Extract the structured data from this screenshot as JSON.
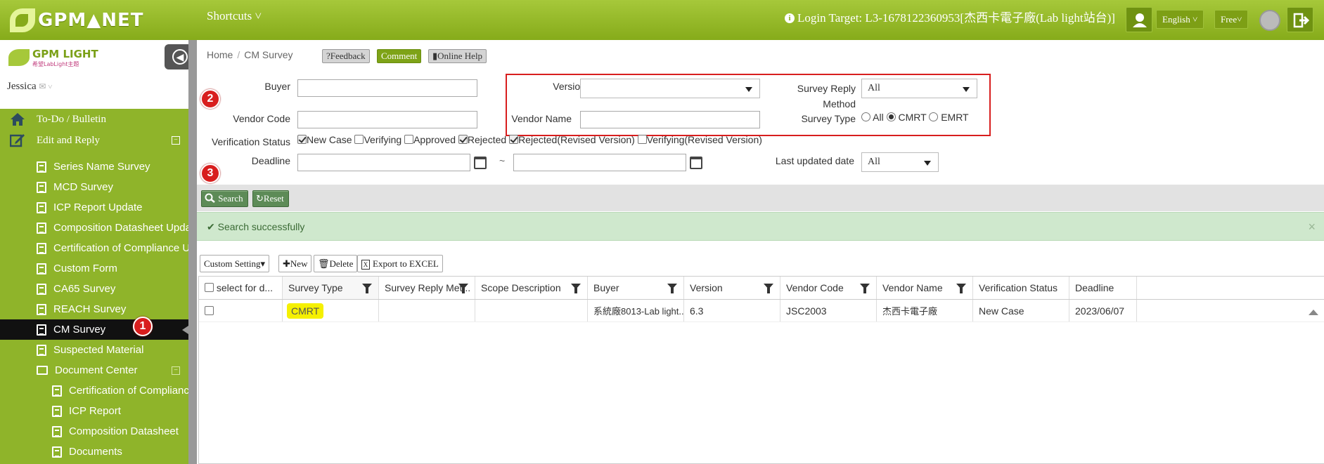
{
  "topbar": {
    "logo_text": "GPM▲NET",
    "shortcuts_label": "Shortcuts",
    "login_target": "Login Target: L3-1678122360953[杰西卡電子廠(Lab light站台)]",
    "language": "English",
    "plan": "Free"
  },
  "sidebar": {
    "logo_text": "GPM LIGHT",
    "logo_sub": "希望LabLight主題",
    "user_name": "Jessica",
    "top_items": [
      {
        "label": "To-Do / Bulletin"
      },
      {
        "label": "Edit and Reply"
      }
    ],
    "items": [
      {
        "label": "Series Name Survey"
      },
      {
        "label": "MCD Survey"
      },
      {
        "label": "ICP Report Update"
      },
      {
        "label": "Composition Datasheet Update"
      },
      {
        "label": "Certification of Compliance Update"
      },
      {
        "label": "Custom Form"
      },
      {
        "label": "CA65 Survey"
      },
      {
        "label": "REACH Survey"
      },
      {
        "label": "CM Survey"
      },
      {
        "label": "Suspected Material"
      },
      {
        "label": "Document Center"
      }
    ],
    "sub_items": [
      {
        "label": "Certification of Compliance"
      },
      {
        "label": "ICP Report"
      },
      {
        "label": "Composition Datasheet"
      },
      {
        "label": "Documents"
      }
    ]
  },
  "badges": {
    "one": "1",
    "two": "2",
    "three": "3"
  },
  "breadcrumb": {
    "home": "Home",
    "separator": "/",
    "current": "CM Survey"
  },
  "header_buttons": {
    "feedback": "?Feedback",
    "comment": "Comment",
    "help": "Online Help"
  },
  "form": {
    "buyer_label": "Buyer",
    "buyer_value": "",
    "vendor_code_label": "Vendor Code",
    "vendor_code_value": "",
    "version_label": "Version",
    "version_value": "",
    "vendor_name_label": "Vendor Name",
    "vendor_name_value": "",
    "reply_method_label": "Survey Reply Method",
    "reply_method_value": "All",
    "survey_type_label": "Survey Type",
    "survey_type_options": [
      "All",
      "CMRT",
      "EMRT"
    ],
    "survey_type_selected": "CMRT",
    "verification_label": "Verification Status",
    "verification_options": [
      {
        "label": "New Case",
        "checked": true
      },
      {
        "label": "Verifying",
        "checked": false
      },
      {
        "label": "Approved",
        "checked": false
      },
      {
        "label": "Rejected",
        "checked": true
      },
      {
        "label": "Rejected(Revised Version)",
        "checked": true
      },
      {
        "label": "Verifying(Revised Version)",
        "checked": false
      }
    ],
    "deadline_label": "Deadline",
    "deadline_sep": "~",
    "last_updated_label": "Last updated date",
    "last_updated_value": "All"
  },
  "toolbar": {
    "search": "Search",
    "reset": "Reset"
  },
  "message": {
    "text": "Search successfully",
    "close": "×"
  },
  "grid_toolbar": {
    "custom": "Custom Setting",
    "new": "New",
    "delete": "Delete",
    "export": "Export to EXCEL"
  },
  "grid": {
    "columns": [
      "select for d...",
      "Survey Type",
      "Survey Reply Met...",
      "Scope Description",
      "Buyer",
      "Version",
      "Vendor Code",
      "Vendor Name",
      "Verification Status",
      "Deadline"
    ],
    "rows": [
      {
        "survey_type": "CMRT",
        "reply_method": "",
        "scope": "",
        "buyer": "系統廠8013-Lab light...",
        "version": "6.3",
        "vendor_code": "JSC2003",
        "vendor_name": "杰西卡電子廠",
        "status": "New Case",
        "deadline": "2023/06/07"
      }
    ]
  }
}
